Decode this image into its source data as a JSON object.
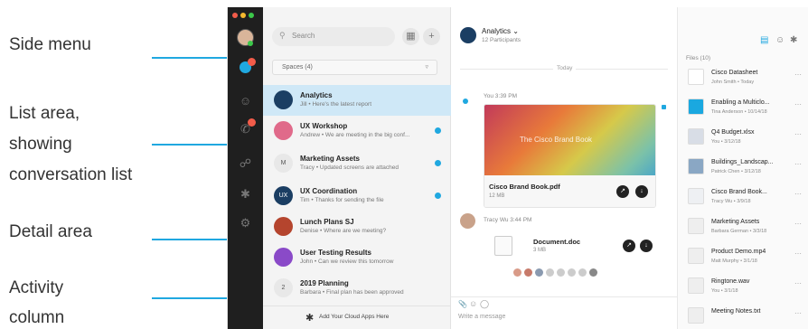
{
  "callouts": {
    "side_menu": "Side menu",
    "list_area_1": "List area,",
    "list_area_2": "showing",
    "list_area_3": "conversation list",
    "detail_area": "Detail area",
    "activity_1": "Activity",
    "activity_2": "column"
  },
  "colors": {
    "accent": "#20a8e0",
    "sidebar": "#1f1f1f",
    "selected_row": "#cfe8f7",
    "badge": "#f25c4a"
  },
  "list": {
    "search_placeholder": "Search",
    "filter_label": "Spaces (4)",
    "conversations": [
      {
        "title": "Analytics",
        "sub": "Jill • Here's the latest report",
        "initial": "",
        "unread": false,
        "selected": true
      },
      {
        "title": "UX Workshop",
        "sub": "Andrew • We are meeting in the big conf...",
        "initial": "",
        "unread": true,
        "selected": false
      },
      {
        "title": "Marketing Assets",
        "sub": "Tracy • Updated screens are attached",
        "initial": "M",
        "unread": true,
        "selected": false
      },
      {
        "title": "UX Coordination",
        "sub": "Tim • Thanks for sending the file",
        "initial": "UX",
        "unread": true,
        "selected": false
      },
      {
        "title": "Lunch Plans SJ",
        "sub": "Denise • Where are we meeting?",
        "initial": "",
        "unread": false,
        "selected": false
      },
      {
        "title": "User Testing Results",
        "sub": "John • Can we review this tomorrow",
        "initial": "",
        "unread": false,
        "selected": false
      },
      {
        "title": "2019 Planning",
        "sub": "Barbara • Final plan has been approved",
        "initial": "2",
        "unread": false,
        "selected": false
      }
    ],
    "footer": "Add Your Cloud Apps Here"
  },
  "detail": {
    "title": "Analytics ⌄",
    "participants": "12 Participants",
    "today": "Today",
    "msg1_meta": "You 3:39 PM",
    "card_image_text": "The Cisco Brand Book",
    "card_name": "Cisco Brand Book.pdf",
    "card_size": "12 MB",
    "msg2_meta": "Tracy Wu 3:44 PM",
    "doc_name": "Document.doc",
    "doc_size": "3 MB",
    "composer_placeholder": "Write a message"
  },
  "activity": {
    "files_header": "Files (10)",
    "files": [
      {
        "name": "Cisco Datasheet",
        "sub": "John Smith • Today",
        "thumb": "#ffffff"
      },
      {
        "name": "Enabling a Multiclo...",
        "sub": "Tina Anderson • 10/14/18",
        "thumb": "#1aa8e0"
      },
      {
        "name": "Q4 Budget.xlsx",
        "sub": "You • 3/12/18",
        "thumb": "#d8dde6"
      },
      {
        "name": "Buildings_Landscap...",
        "sub": "Patrick Chen • 3/12/18",
        "thumb": "#8aa7c4"
      },
      {
        "name": "Cisco Brand Book...",
        "sub": "Tracy Wu • 3/9/18",
        "thumb": "#eef0f3"
      },
      {
        "name": "Marketing Assets",
        "sub": "Barbara German • 3/3/18",
        "thumb": "#eeeeee"
      },
      {
        "name": "Product Demo.mp4",
        "sub": "Matt Murphy • 3/1/18",
        "thumb": "#eeeeee"
      },
      {
        "name": "Ringtone.wav",
        "sub": "You • 3/1/18",
        "thumb": "#eeeeee"
      },
      {
        "name": "Meeting Notes.txt",
        "sub": "",
        "thumb": "#eeeeee"
      }
    ]
  }
}
